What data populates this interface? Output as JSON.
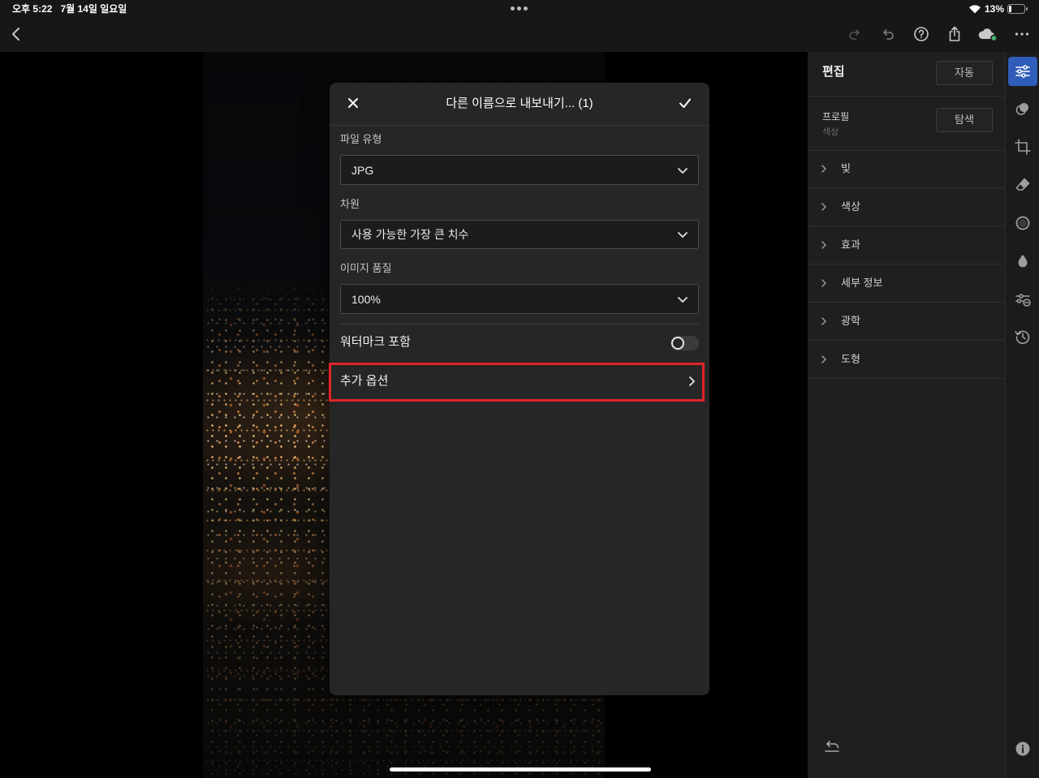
{
  "status_bar": {
    "time": "오후 5:22",
    "date": "7월 14일 일요일",
    "battery": "13%"
  },
  "theme": {
    "accent": "#2f5db9",
    "annotation": "#e1242b",
    "sync_dot": "#3fb36b"
  },
  "toolbar": {
    "icons": [
      "chevron-left-icon",
      "redo-icon",
      "undo-icon",
      "help-icon",
      "share-icon",
      "cloud-sync-icon",
      "more-icon"
    ]
  },
  "dialog": {
    "title": "다른 이름으로 내보내기... (1)",
    "file_type": {
      "label": "파일 유형",
      "value": "JPG"
    },
    "dimensions": {
      "label": "차원",
      "value": "사용 가능한 가장 큰 치수"
    },
    "quality": {
      "label": "이미지 품질",
      "value": "100%"
    },
    "watermark": {
      "label": "워터마크 포함",
      "enabled": false
    },
    "more_options": {
      "label": "추가 옵션"
    }
  },
  "edit_panel": {
    "title": "편집",
    "auto_button": "자동",
    "profile": {
      "label": "프로필",
      "value": "색상",
      "browse_button": "탐색"
    },
    "sections": [
      "빛",
      "색상",
      "효과",
      "세부 정보",
      "광학",
      "도형"
    ]
  },
  "tool_strip": {
    "active_icon": "edit-icon",
    "icons": [
      "edit-icon",
      "masking-icon",
      "crop-icon",
      "healing-icon",
      "selective-icon",
      "blur-icon",
      "presets-icon",
      "history-icon",
      "info-icon"
    ]
  }
}
